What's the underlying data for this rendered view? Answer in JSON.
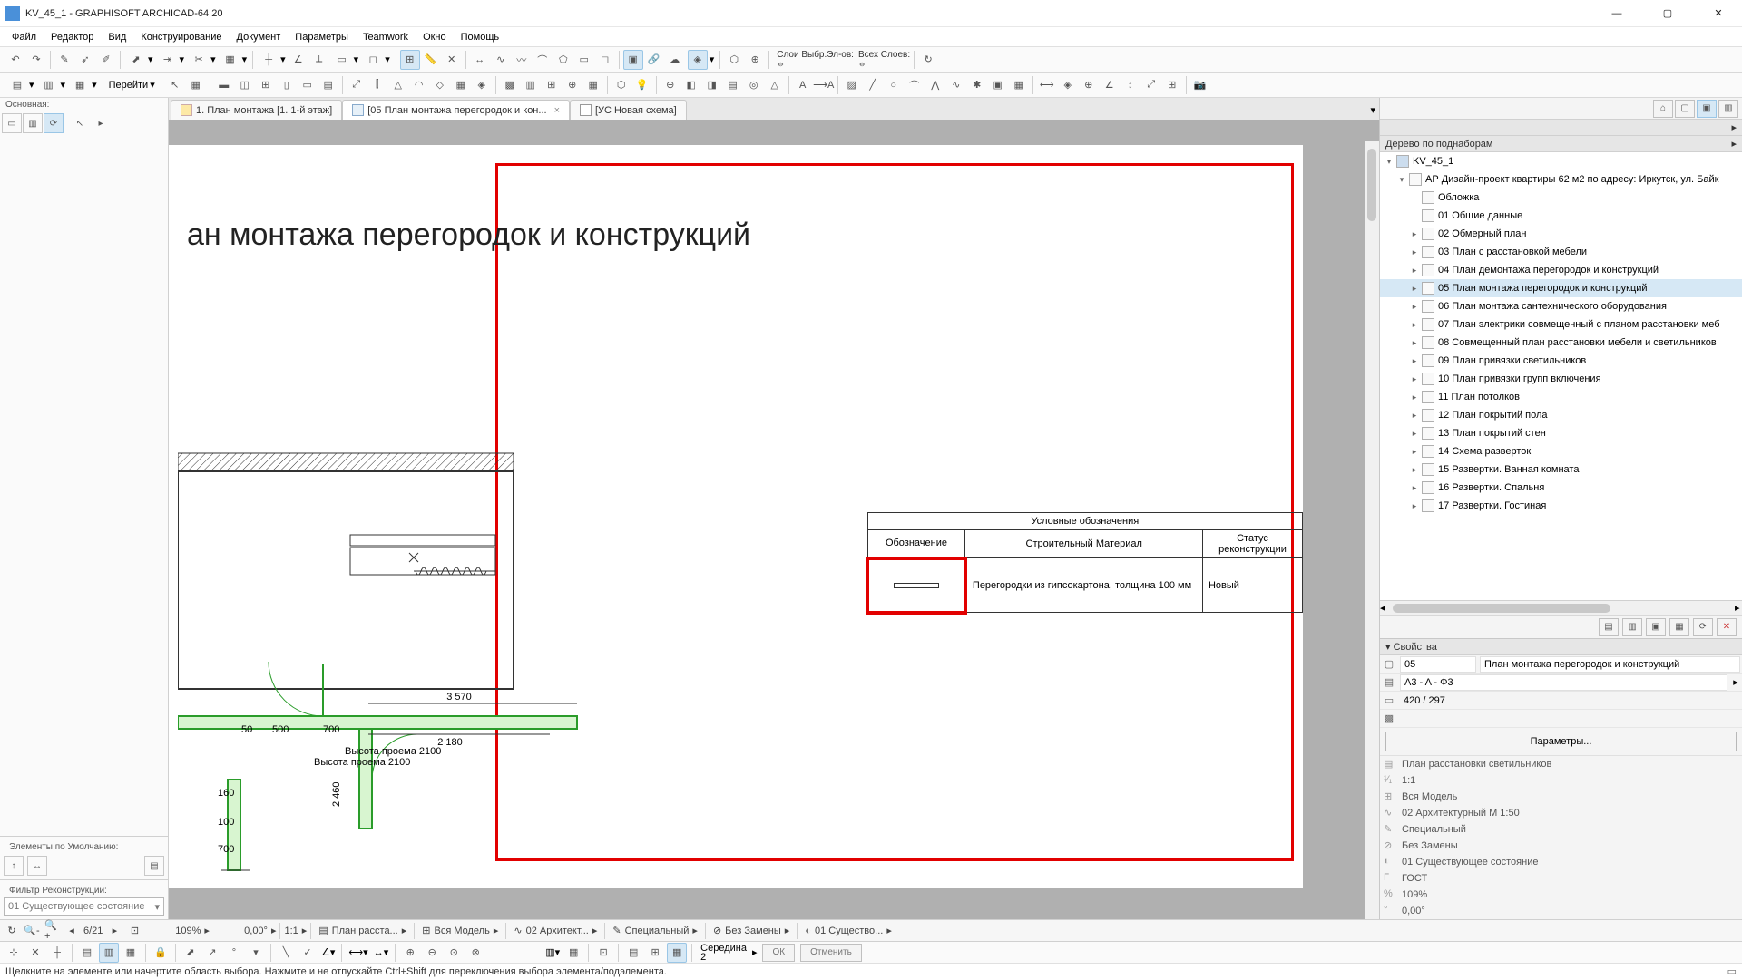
{
  "title": "KV_45_1 - GRAPHISOFT ARCHICAD-64 20",
  "menu": [
    "Файл",
    "Редактор",
    "Вид",
    "Конструирование",
    "Документ",
    "Параметры",
    "Teamwork",
    "Окно",
    "Помощь"
  ],
  "toolbar_layers": {
    "label1": "Слои Выбр.Эл-ов:",
    "label2": "Всех Слоев:"
  },
  "tabs": [
    {
      "label": "1. План монтажа [1. 1-й этаж]",
      "active": false,
      "closable": false
    },
    {
      "label": "[05 План монтажа перегородок и кон...",
      "active": true,
      "closable": true
    },
    {
      "label": "[УС Новая схема]",
      "active": false,
      "closable": false
    }
  ],
  "left": {
    "main_label": "Основная:",
    "defaults_label": "Элементы по Умолчанию:",
    "filter_label": "Фильтр Реконструкции:",
    "filter_value": "01 Существующее состояние"
  },
  "canvas": {
    "title_visible": "ан монтажа перегородок и конструкций",
    "legend_header": "Условные обозначения",
    "col1": "Обозначение",
    "col2": "Строительный Материал",
    "col3": "Статус реконструкции",
    "row_material": "Перегородки из гипсокартона, толщина 100 мм",
    "row_status": "Новый",
    "dim1": "3 570",
    "dim2": "2 180",
    "dim3": "2 460",
    "dim4": "160",
    "dim5": "50",
    "dim6": "100",
    "dim7": "500",
    "dim8": "700",
    "note1": "Высота проема 2100",
    "note2": "Высота проема 2100"
  },
  "right_header": "Дерево по поднаборам",
  "tree_root": "KV_45_1",
  "tree_project": "АР Дизайн-проект квартиры 62 м2 по адресу: Иркутск, ул. Байк",
  "tree_items": [
    "Обложка",
    "01 Общие данные",
    "02 Обмерный план",
    "03 План с расстановкой мебели",
    "04 План демонтажа перегородок и конструкций",
    "05 План монтажа перегородок и конструкций",
    "06 План монтажа сантехнического оборудования",
    "07 План электрики совмещенный с планом расстановки меб",
    "08 Совмещенный план расстановки мебели и светильников",
    "09 План привязки светильников",
    "10 План привязки групп включения",
    "11 План потолков",
    "12 План покрытий пола",
    "13 План покрытий стен",
    "14 Схема разверток",
    "15 Развертки. Ванная комната",
    "16 Развертки. Спальня",
    "17 Развертки. Гостиная"
  ],
  "tree_selected_index": 5,
  "props_header": "Свойства",
  "props": {
    "number": "05",
    "name": "План монтажа перегородок и конструкций",
    "layout": "A3 - A - Ф3",
    "size": "420 / 297"
  },
  "params_btn": "Параметры...",
  "status_items": [
    "План расстановки светильников",
    "1:1",
    "Вся Модель",
    "02 Архитектурный М 1:50",
    "Специальный",
    "Без Замены",
    "01 Существующее состояние",
    "ГОСТ",
    "109%",
    "0,00°"
  ],
  "nav": {
    "page": "6/21",
    "zoom": "109%",
    "coord": "0,00°",
    "scale": "1:1",
    "view": "План расста...",
    "model": "Вся Модель",
    "arch": "02 Архитект...",
    "special": "Специальный",
    "nozam": "Без Замены",
    "exist": "01 Существо...",
    "gost_label": "Середина",
    "gost_num": "2"
  },
  "ok": "ОК",
  "cancel": "Отменить",
  "status_hint": "Щелкните на элементе или начертите область выбора. Нажмите и не отпускайте Ctrl+Shift для переключения выбора элемента/подэлемента.",
  "go": "Перейти"
}
